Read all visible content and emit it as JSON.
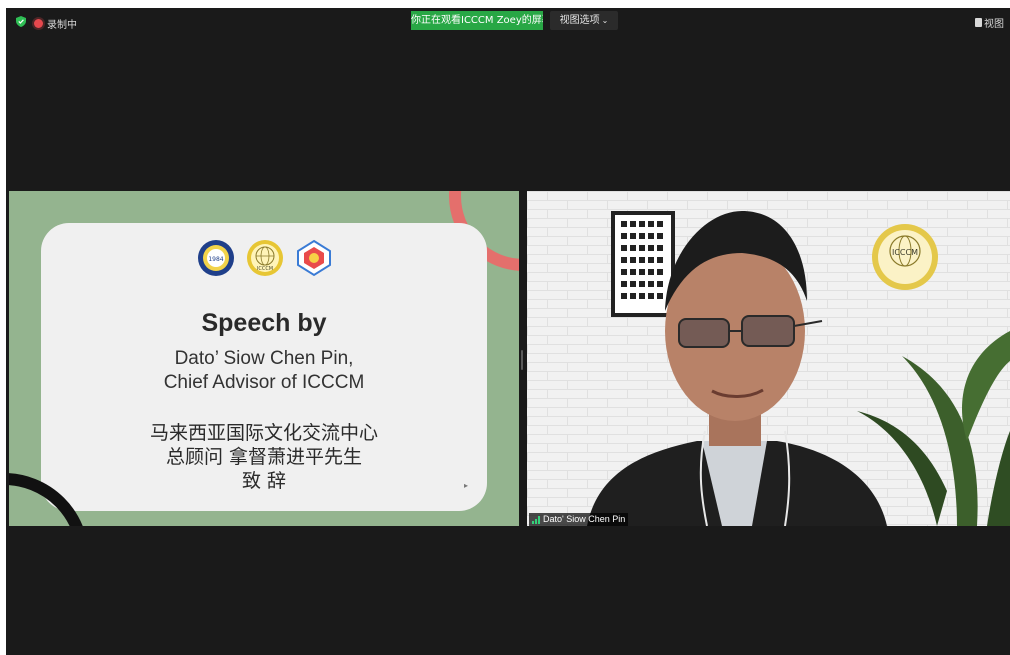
{
  "topbar": {
    "recording_label": "录制中",
    "sharing_banner": "你正在观看ICCCM Zoey的屏幕",
    "view_options_label": "视图选项",
    "view_label": "视图"
  },
  "slide": {
    "title": "Speech by",
    "line1": "Dato’ Siow Chen Pin,",
    "line2": "Chief Advisor of ICCCM",
    "cn_line1": "马来西亚国际文化交流中心",
    "cn_line2": "总顾问 拿督萧进平先生",
    "cn_line3": "致 辞",
    "logo1_text": "1984",
    "logo2_text": "ICCCM"
  },
  "video": {
    "participant_name": "Dato' Siow Chen Pin",
    "wall_logo_text": "ICCCM"
  },
  "colors": {
    "background": "#1a1a1a",
    "banner_green": "#28a745",
    "slide_green": "#94b48f",
    "accent_coral": "#e46f6c",
    "recording_red": "#e5484d"
  }
}
